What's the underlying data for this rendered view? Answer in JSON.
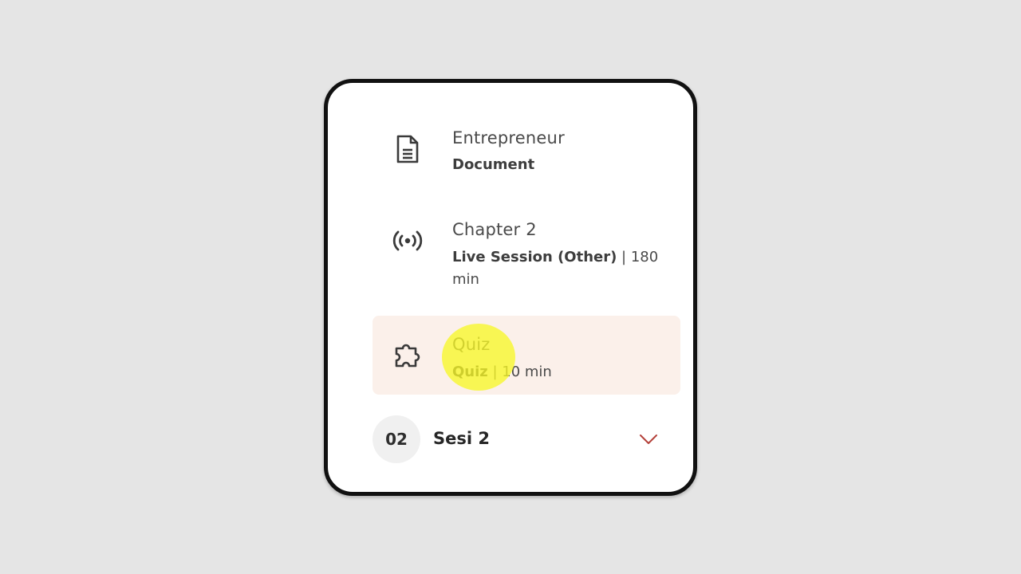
{
  "course_items": [
    {
      "title": "Entrepreneur",
      "type_label": "Document",
      "detail": "",
      "icon": "document-icon"
    },
    {
      "title": "Chapter 2",
      "type_label": "Live Session (Other)",
      "detail": " | 180 min",
      "icon": "broadcast-icon"
    },
    {
      "title": "Quiz",
      "type_label": "Quiz",
      "detail": " | 10 min",
      "icon": "puzzle-icon",
      "active": true
    }
  ],
  "section": {
    "number": "02",
    "label": "Sesi 2",
    "expand_icon": "chevron-down-icon"
  },
  "colors": {
    "active_background": "#fbf0ea",
    "chevron": "#b4413a",
    "cursor_highlight": "#f7f728"
  }
}
